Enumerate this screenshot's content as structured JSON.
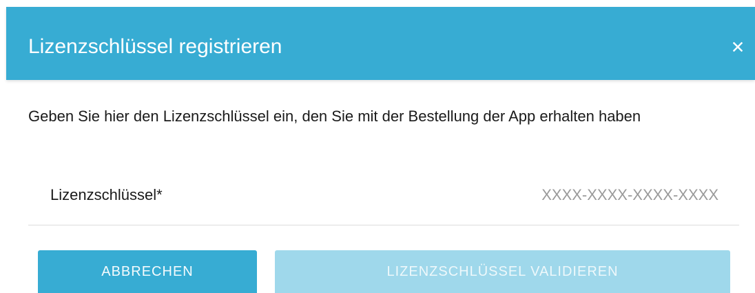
{
  "dialog": {
    "title": "Lizenzschlüssel registrieren",
    "close_icon": "close-icon",
    "description": "Geben Sie hier den Lizenzschlüssel ein, den Sie mit der Bestellung der App erhalten haben",
    "license_field": {
      "label": "Lizenzschlüssel*",
      "value": "",
      "placeholder": "XXXX-XXXX-XXXX-XXXX"
    },
    "buttons": {
      "cancel_label": "ABBRECHEN",
      "validate_label": "LIZENZSCHLÜSSEL VALIDIEREN",
      "validate_disabled": true
    }
  },
  "colors": {
    "header_background": "#37acd3",
    "primary_button": "#37acd3",
    "disabled_button": "#9fd8eb"
  }
}
